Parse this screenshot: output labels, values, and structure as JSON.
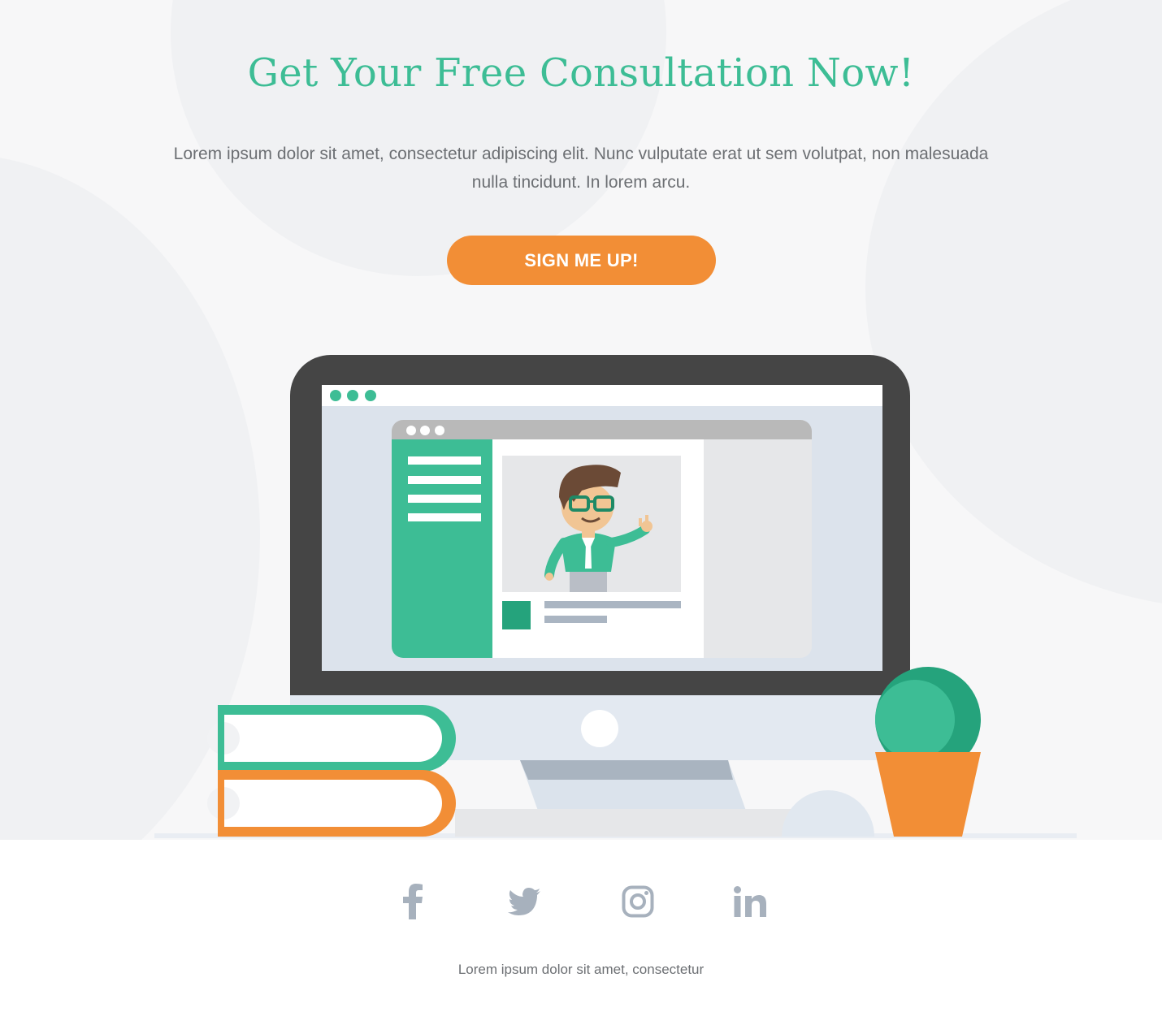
{
  "hero": {
    "title": "Get Your Free Consultation Now!",
    "subtitle": "Lorem ipsum dolor sit amet, consectetur adipiscing elit. Nunc vulputate erat ut sem volutpat, non malesuada nulla tincidunt. In lorem arcu.",
    "cta_label": "SIGN ME UP!"
  },
  "footer": {
    "social": [
      {
        "icon": "facebook-icon"
      },
      {
        "icon": "twitter-icon"
      },
      {
        "icon": "instagram-icon"
      },
      {
        "icon": "linkedin-icon"
      }
    ],
    "footnote": "Lorem ipsum dolor sit amet, consectetur"
  },
  "colors": {
    "accent_green": "#3dbd95",
    "accent_orange": "#f28e36",
    "icon_gray": "#a7b1bd",
    "text_gray": "#6c6f73",
    "monitor_frame": "#454545"
  }
}
